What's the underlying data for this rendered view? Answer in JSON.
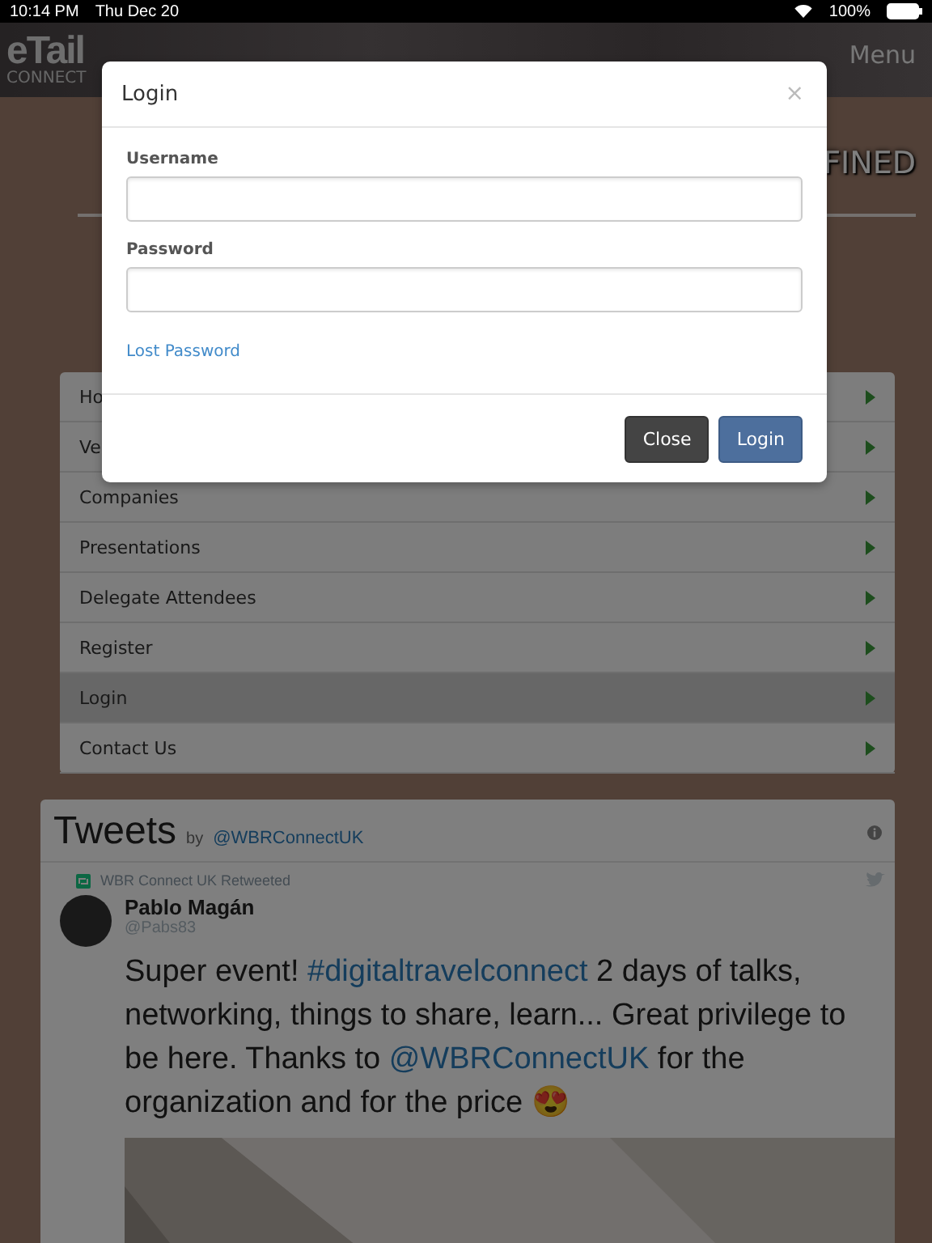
{
  "status_bar": {
    "time": "10:14 PM",
    "date": "Thu Dec 20",
    "battery": "100%"
  },
  "header": {
    "logo_top": "eTail",
    "logo_bottom": "CONNECT",
    "menu": "Menu"
  },
  "hero": {
    "heading": "FINED"
  },
  "nav": [
    {
      "label": "Ho",
      "selected": false
    },
    {
      "label": "Ve",
      "selected": false
    },
    {
      "label": "Companies",
      "selected": false
    },
    {
      "label": "Presentations",
      "selected": false
    },
    {
      "label": "Delegate Attendees",
      "selected": false
    },
    {
      "label": "Register",
      "selected": false
    },
    {
      "label": "Login",
      "selected": true
    },
    {
      "label": "Contact Us",
      "selected": false
    }
  ],
  "tweets": {
    "title": "Tweets",
    "by": "by",
    "handle": "@WBRConnectUK",
    "retweeted": "WBR Connect UK Retweeted",
    "author": "Pablo Magán",
    "author_handle": "@Pabs83",
    "text": [
      {
        "kind": "plain",
        "text": "Super event! "
      },
      {
        "kind": "link",
        "text": "#digitaltravelconnect"
      },
      {
        "kind": "plain",
        "text": " 2 days of talks, networking, things to share, learn... Great privilege to be here. Thanks to "
      },
      {
        "kind": "link",
        "text": "@WBRConnectUK"
      },
      {
        "kind": "plain",
        "text": " for the organization and for the price 😍"
      }
    ]
  },
  "modal": {
    "title": "Login",
    "close": "×",
    "fields": [
      {
        "label": "Username"
      },
      {
        "label": "Password"
      }
    ],
    "lost_password": "Lost Password",
    "buttons": [
      {
        "label": "Close",
        "kind": "secondary"
      },
      {
        "label": "Login",
        "kind": "primary"
      }
    ]
  }
}
